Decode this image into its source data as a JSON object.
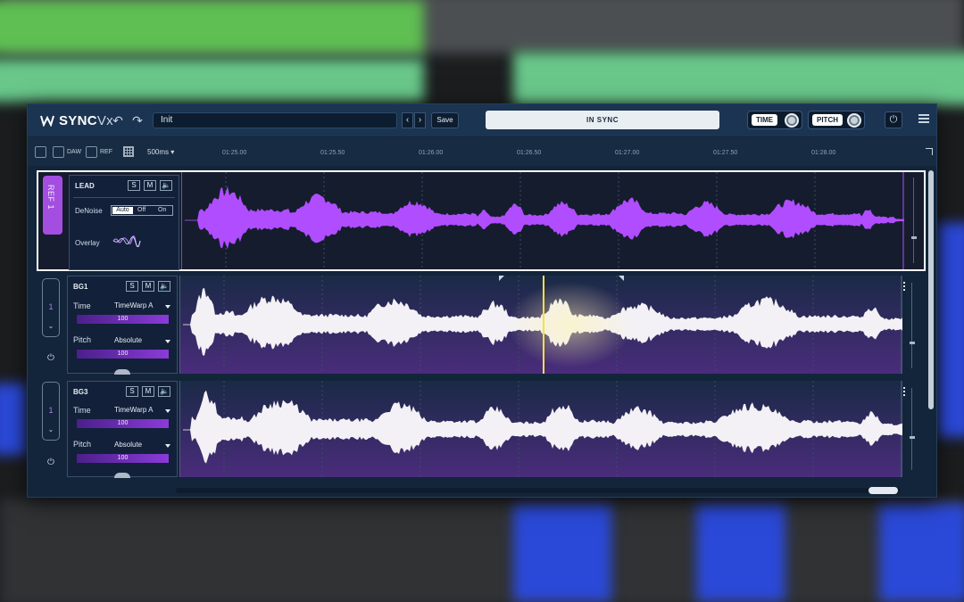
{
  "app": {
    "logo_text": "SYNC",
    "logo_sub": "Vx",
    "preset_name": "Init",
    "save_label": "Save",
    "sync_status": "IN SYNC",
    "time_label": "TIME",
    "pitch_label": "PITCH"
  },
  "toolbar": {
    "daw_label": "DAW",
    "ref_label": "REF",
    "resolution": "500ms"
  },
  "timeline": {
    "ticks": [
      "01:25.00",
      "01:25.50",
      "01:26.00",
      "01:26.50",
      "01:27.00",
      "01:27.50",
      "01:28.00"
    ]
  },
  "tracks": {
    "lead": {
      "ref_label": "REF 1",
      "name": "LEAD",
      "solo": "S",
      "mute": "M",
      "denoise_label": "DeNoise",
      "denoise_options": [
        "Auto",
        "Off",
        "On"
      ],
      "overlay_label": "Overlay"
    },
    "bg1": {
      "name": "BG1",
      "ref_num": "1",
      "solo": "S",
      "mute": "M",
      "time_label": "Time",
      "time_mode": "TimeWarp A",
      "time_value": "100",
      "pitch_label": "Pitch",
      "pitch_mode": "Absolute",
      "pitch_value": "100"
    },
    "bg3": {
      "name": "BG3",
      "ref_num": "1",
      "solo": "S",
      "mute": "M",
      "time_label": "Time",
      "time_mode": "TimeWarp A",
      "time_value": "100",
      "pitch_label": "Pitch",
      "pitch_mode": "Absolute",
      "pitch_value": "100"
    }
  },
  "colors": {
    "lead_wave": "#b04dff",
    "bg_wave": "#f3f1f5",
    "accent": "#a34ee0",
    "playhead": "#f6e04a"
  }
}
